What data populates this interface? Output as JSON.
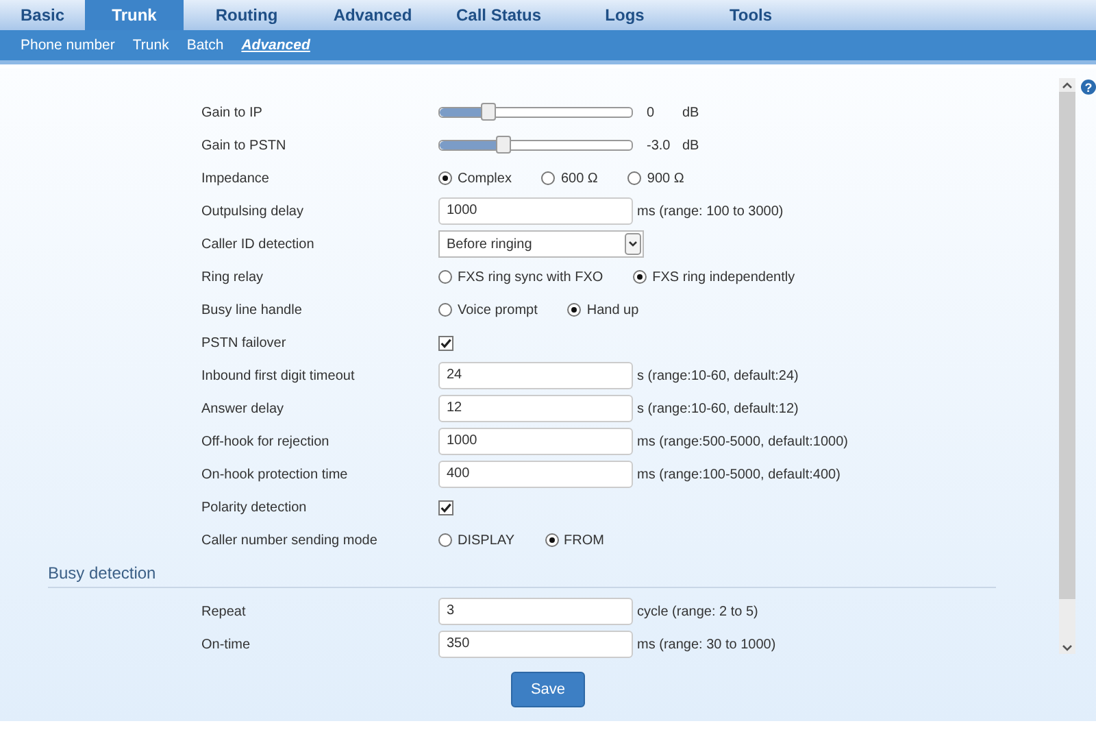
{
  "tabs": [
    {
      "label": "Basic",
      "selected": false
    },
    {
      "label": "Trunk",
      "selected": true
    },
    {
      "label": "Routing",
      "selected": false
    },
    {
      "label": "Advanced",
      "selected": false
    },
    {
      "label": "Call Status",
      "selected": false
    },
    {
      "label": "Logs",
      "selected": false
    },
    {
      "label": "Tools",
      "selected": false
    }
  ],
  "subtabs": [
    {
      "label": "Phone number",
      "selected": false
    },
    {
      "label": "Trunk",
      "selected": false
    },
    {
      "label": "Batch",
      "selected": false
    },
    {
      "label": "Advanced",
      "selected": true
    }
  ],
  "help": "?",
  "fields": [
    {
      "kind": "slider",
      "label": "Gain to IP",
      "level": 0.25,
      "value": "0",
      "unit": "dB"
    },
    {
      "kind": "slider",
      "label": "Gain to PSTN",
      "level": 0.33,
      "value": "-3.0",
      "unit": "dB"
    },
    {
      "kind": "radio",
      "label": "Impedance",
      "options": [
        {
          "label": "Complex",
          "selected": true
        },
        {
          "label": "600 Ω",
          "selected": false
        },
        {
          "label": "900 Ω",
          "selected": false
        }
      ]
    },
    {
      "kind": "input",
      "label": "Outpulsing delay",
      "value": "1000",
      "hint": "ms (range: 100 to 3000)"
    },
    {
      "kind": "select",
      "label": "Caller ID detection",
      "value": "Before ringing"
    },
    {
      "kind": "radio",
      "label": "Ring relay",
      "options": [
        {
          "label": "FXS ring sync with FXO",
          "selected": false
        },
        {
          "label": "FXS ring independently",
          "selected": true
        }
      ]
    },
    {
      "kind": "radio",
      "label": "Busy line handle",
      "options": [
        {
          "label": "Voice prompt",
          "selected": false
        },
        {
          "label": "Hand up",
          "selected": true
        }
      ]
    },
    {
      "kind": "checkbox",
      "label": "PSTN failover",
      "checked": true
    },
    {
      "kind": "input",
      "label": "Inbound first digit timeout",
      "value": "24",
      "hint": "s (range:10-60, default:24)"
    },
    {
      "kind": "input",
      "label": "Answer delay",
      "value": "12",
      "hint": "s (range:10-60, default:12)"
    },
    {
      "kind": "input",
      "label": "Off-hook for rejection",
      "value": "1000",
      "hint": "ms (range:500-5000, default:1000)"
    },
    {
      "kind": "input",
      "label": "On-hook protection time",
      "value": "400",
      "hint": "ms (range:100-5000, default:400)"
    },
    {
      "kind": "checkbox",
      "label": "Polarity detection",
      "checked": true
    },
    {
      "kind": "radio",
      "label": "Caller number sending mode",
      "options": [
        {
          "label": "DISPLAY",
          "selected": false
        },
        {
          "label": "FROM",
          "selected": true
        }
      ]
    }
  ],
  "busy_detection": {
    "title": "Busy detection",
    "fields": [
      {
        "kind": "input",
        "label": "Repeat",
        "value": "3",
        "hint": "cycle (range: 2 to 5)"
      },
      {
        "kind": "input",
        "label": "On-time",
        "value": "350",
        "hint": "ms (range: 30 to 1000)"
      }
    ]
  },
  "save_button": "Save"
}
